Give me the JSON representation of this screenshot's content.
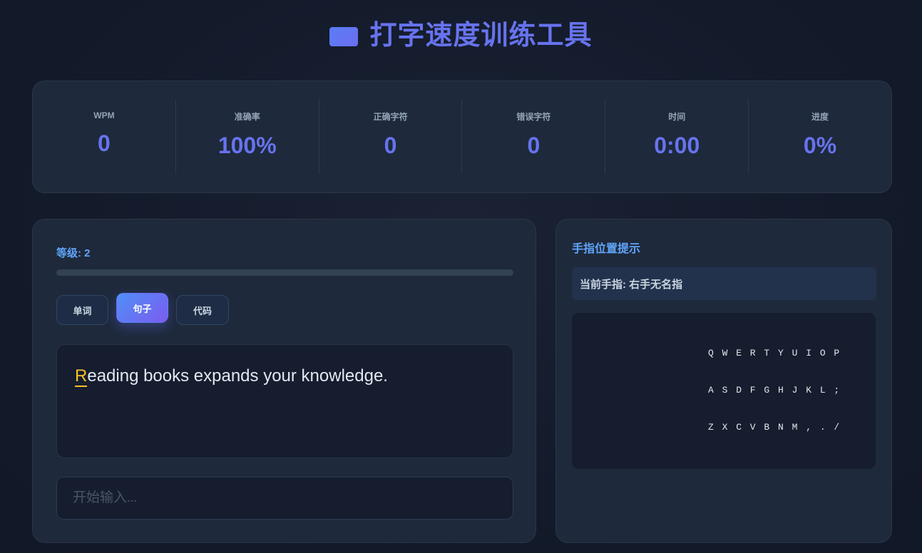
{
  "header": {
    "title": "打字速度训练工具",
    "icon": "keyboard-icon"
  },
  "stats": [
    {
      "label": "WPM",
      "value": "0"
    },
    {
      "label": "准确率",
      "value": "100%"
    },
    {
      "label": "正确字符",
      "value": "0"
    },
    {
      "label": "错误字符",
      "value": "0"
    },
    {
      "label": "时间",
      "value": "0:00"
    },
    {
      "label": "进度",
      "value": "0%"
    }
  ],
  "practice": {
    "level_label": "等级: 2",
    "level_progress": 0,
    "modes": [
      {
        "label": "单词",
        "active": false
      },
      {
        "label": "句子",
        "active": true
      },
      {
        "label": "代码",
        "active": false
      }
    ],
    "text_current_char": "R",
    "text_rest": "eading books expands your knowledge.",
    "input_value": "",
    "input_placeholder": "开始输入..."
  },
  "finger_hint": {
    "title": "手指位置提示",
    "current_finger": "当前手指: 右手无名指",
    "keyboard_rows": [
      "Q W E R T Y U I O P",
      "A S D F G H J K L ;",
      "Z X C V B N M , . /"
    ]
  },
  "colors": {
    "accent": "#6773ee",
    "label_blue": "#60a5fa",
    "highlight": "#fbbf24",
    "card_bg": "#1e293b"
  }
}
